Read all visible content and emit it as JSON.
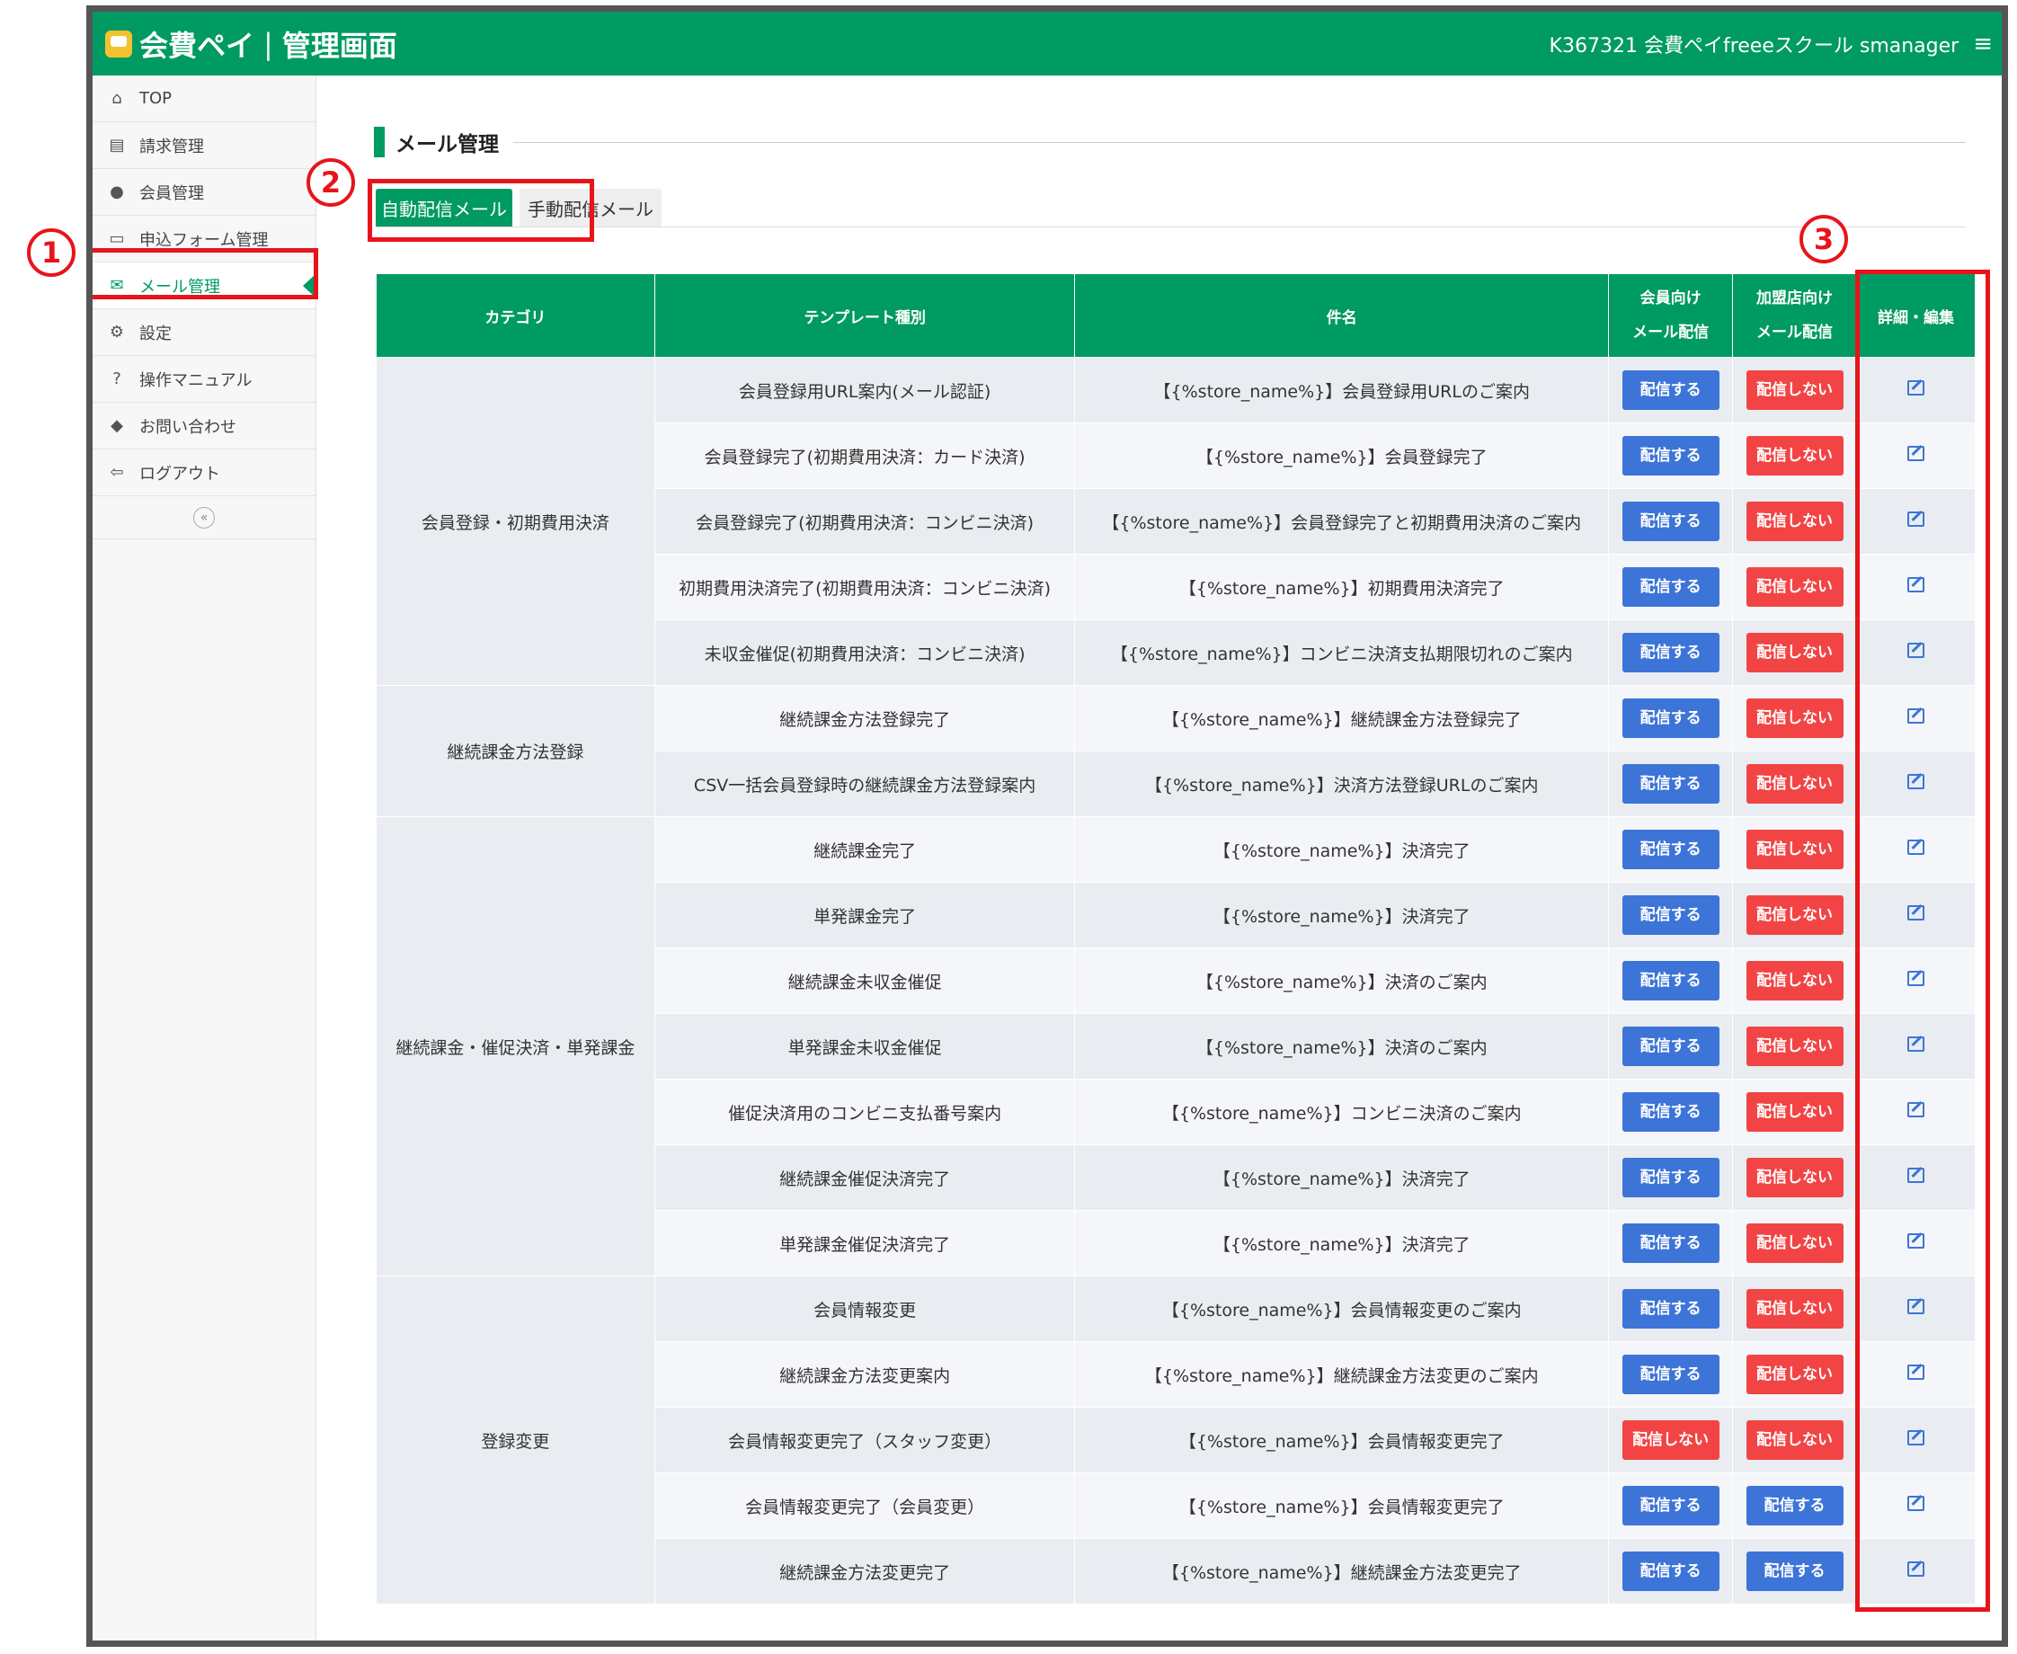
{
  "header": {
    "brand_name": "会費ペイ",
    "brand_separator": "|",
    "brand_suffix": "管理画面",
    "account": "K367321 会費ペイfreeeスクール smanager",
    "menu_icon": "hamburger-icon"
  },
  "sidebar": {
    "items": [
      {
        "label": "TOP",
        "icon": "home-icon"
      },
      {
        "label": "請求管理",
        "icon": "book-icon"
      },
      {
        "label": "会員管理",
        "icon": "user-icon"
      },
      {
        "label": "申込フォーム管理",
        "icon": "form-icon"
      },
      {
        "label": "メール管理",
        "icon": "envelope-icon",
        "active": true
      },
      {
        "label": "設定",
        "icon": "gear-icon"
      },
      {
        "label": "操作マニュアル",
        "icon": "question-icon"
      },
      {
        "label": "お問い合わせ",
        "icon": "chat-icon"
      },
      {
        "label": "ログアウト",
        "icon": "logout-icon"
      }
    ],
    "collapse_label": "«"
  },
  "page": {
    "title": "メール管理",
    "tabs": [
      "自動配信メール",
      "手動配信メール"
    ]
  },
  "table": {
    "headers": {
      "category": "カテゴリ",
      "template": "テンプレート種別",
      "subject": "件名",
      "member_line1": "会員向け",
      "member_line2": "メール配信",
      "store_line1": "加盟店向け",
      "store_line2": "メール配信",
      "edit": "詳細・編集"
    },
    "categories": [
      "会員登録・初期費用決済",
      "継続課金方法登録",
      "継続課金・催促決済・単発課金",
      "登録変更"
    ],
    "rows": [
      {
        "template": "会員登録用URL案内(メール認証)",
        "subject": "【{%store_name%}】会員登録用URLのご案内",
        "member": "配信する",
        "store": "配信しない"
      },
      {
        "template": "会員登録完了(初期費用決済：カード決済)",
        "subject": "【{%store_name%}】会員登録完了",
        "member": "配信する",
        "store": "配信しない"
      },
      {
        "template": "会員登録完了(初期費用決済：コンビニ決済)",
        "subject": "【{%store_name%}】会員登録完了と初期費用決済のご案内",
        "member": "配信する",
        "store": "配信しない"
      },
      {
        "template": "初期費用決済完了(初期費用決済：コンビニ決済)",
        "subject": "【{%store_name%}】初期費用決済完了",
        "member": "配信する",
        "store": "配信しない"
      },
      {
        "template": "未収金催促(初期費用決済：コンビニ決済)",
        "subject": "【{%store_name%}】コンビニ決済支払期限切れのご案内",
        "member": "配信する",
        "store": "配信しない"
      },
      {
        "template": "継続課金方法登録完了",
        "subject": "【{%store_name%}】継続課金方法登録完了",
        "member": "配信する",
        "store": "配信しない"
      },
      {
        "template": "CSV一括会員登録時の継続課金方法登録案内",
        "subject": "【{%store_name%}】決済方法登録URLのご案内",
        "member": "配信する",
        "store": "配信しない"
      },
      {
        "template": "継続課金完了",
        "subject": "【{%store_name%}】決済完了",
        "member": "配信する",
        "store": "配信しない"
      },
      {
        "template": "単発課金完了",
        "subject": "【{%store_name%}】決済完了",
        "member": "配信する",
        "store": "配信しない"
      },
      {
        "template": "継続課金未収金催促",
        "subject": "【{%store_name%}】決済のご案内",
        "member": "配信する",
        "store": "配信しない"
      },
      {
        "template": "単発課金未収金催促",
        "subject": "【{%store_name%}】決済のご案内",
        "member": "配信する",
        "store": "配信しない"
      },
      {
        "template": "催促決済用のコンビニ支払番号案内",
        "subject": "【{%store_name%}】コンビニ決済のご案内",
        "member": "配信する",
        "store": "配信しない"
      },
      {
        "template": "継続課金催促決済完了",
        "subject": "【{%store_name%}】決済完了",
        "member": "配信する",
        "store": "配信しない"
      },
      {
        "template": "単発課金催促決済完了",
        "subject": "【{%store_name%}】決済完了",
        "member": "配信する",
        "store": "配信しない"
      },
      {
        "template": "会員情報変更",
        "subject": "【{%store_name%}】会員情報変更のご案内",
        "member": "配信する",
        "store": "配信しない"
      },
      {
        "template": "継続課金方法変更案内",
        "subject": "【{%store_name%}】継続課金方法変更のご案内",
        "member": "配信する",
        "store": "配信しない"
      },
      {
        "template": "会員情報変更完了（スタッフ変更）",
        "subject": "【{%store_name%}】会員情報変更完了",
        "member": "配信しない",
        "store": "配信しない"
      },
      {
        "template": "会員情報変更完了（会員変更）",
        "subject": "【{%store_name%}】会員情報変更完了",
        "member": "配信する",
        "store": "配信する"
      },
      {
        "template": "継続課金方法変更完了",
        "subject": "【{%store_name%}】継続課金方法変更完了",
        "member": "配信する",
        "store": "配信する"
      }
    ]
  },
  "annotations": [
    "1",
    "2",
    "3"
  ],
  "colors": {
    "brand_green": "#009a63",
    "button_blue": "#3d74d8",
    "button_red": "#f24444",
    "highlight_red": "#e8141c"
  }
}
